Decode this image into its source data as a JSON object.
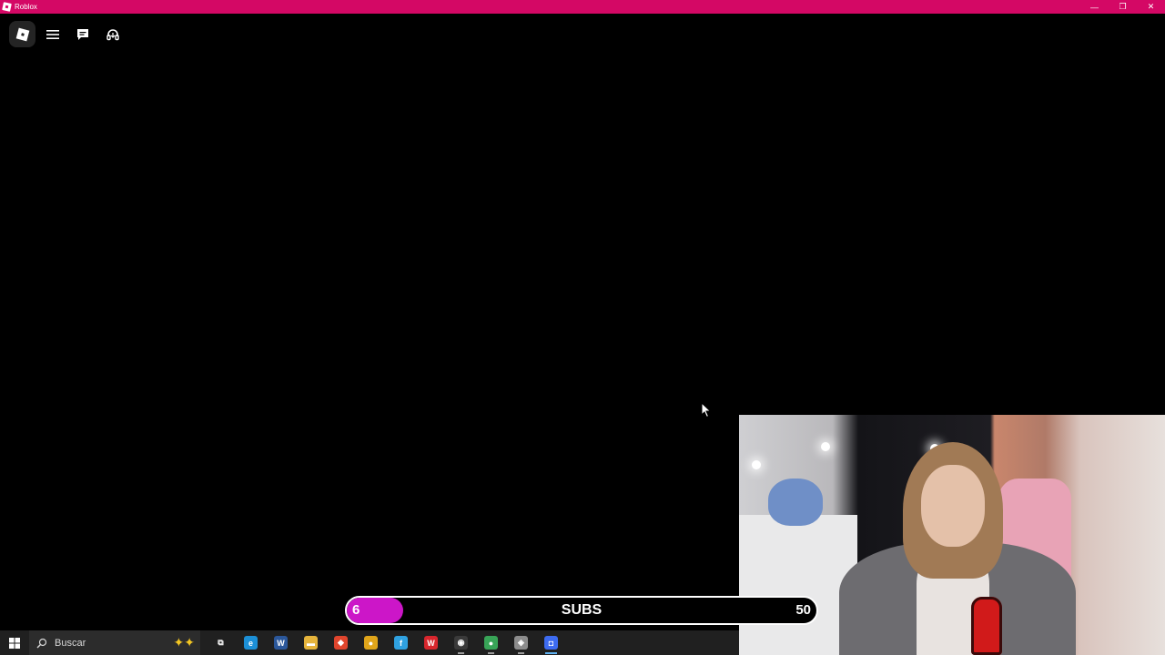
{
  "window": {
    "title": "Roblox",
    "controls": {
      "minimize": "—",
      "restore": "❐",
      "close": "✕"
    }
  },
  "roblox_menu": {
    "icons": [
      "roblox-logo-icon",
      "hamburger-menu-icon",
      "chat-icon",
      "headset-icon"
    ]
  },
  "subs_goal": {
    "current": "6",
    "label": "SUBS",
    "goal": "50",
    "progress_fraction": 0.12,
    "fill_color": "#cc16c8"
  },
  "taskbar": {
    "search_placeholder": "Buscar",
    "apps": [
      {
        "name": "task-view-icon",
        "glyph": "⧉",
        "color": "#202020",
        "state": ""
      },
      {
        "name": "edge-icon",
        "glyph": "e",
        "color": "#1c8fd6",
        "state": ""
      },
      {
        "name": "word-icon",
        "glyph": "W",
        "color": "#2b579a",
        "state": ""
      },
      {
        "name": "file-explorer-icon",
        "glyph": "▬",
        "color": "#e6b43c",
        "state": ""
      },
      {
        "name": "recorder-icon",
        "glyph": "◆",
        "color": "#e0452d",
        "state": ""
      },
      {
        "name": "chrome-icon",
        "glyph": "●",
        "color": "#e0a51a",
        "state": ""
      },
      {
        "name": "app-f-icon",
        "glyph": "f",
        "color": "#2fa1e0",
        "state": ""
      },
      {
        "name": "wps-icon",
        "glyph": "W",
        "color": "#d8262d",
        "state": ""
      },
      {
        "name": "obs-icon",
        "glyph": "◉",
        "color": "#3a3a3a",
        "state": "running"
      },
      {
        "name": "chrome-profile-icon",
        "glyph": "●",
        "color": "#38a457",
        "state": "running"
      },
      {
        "name": "shield-icon",
        "glyph": "◈",
        "color": "#8d8d8d",
        "state": "running"
      },
      {
        "name": "roblox-taskbar-icon",
        "glyph": "◘",
        "color": "#3d6bf0",
        "state": "active"
      }
    ]
  },
  "colors": {
    "titlebar": "#d40865",
    "taskbar": "#202020"
  }
}
